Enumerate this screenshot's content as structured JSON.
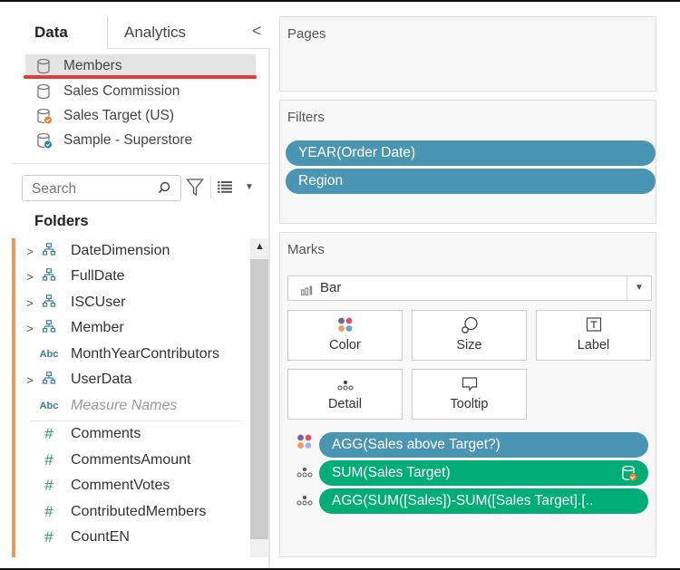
{
  "tabs": {
    "data": "Data",
    "analytics": "Analytics",
    "collapse_glyph": "<"
  },
  "datasources": [
    {
      "name": "Members",
      "icon": "database-icon",
      "selected": true
    },
    {
      "name": "Sales Commission",
      "icon": "database-icon",
      "selected": false
    },
    {
      "name": "Sales Target (US)",
      "icon": "database-secondary-icon",
      "selected": false
    },
    {
      "name": "Sample - Superstore",
      "icon": "database-primary-icon",
      "selected": false
    }
  ],
  "search": {
    "placeholder": "Search"
  },
  "folders_label": "Folders",
  "fields": [
    {
      "name": "DateDimension",
      "type": "hierarchy",
      "expandable": true
    },
    {
      "name": "FullDate",
      "type": "hierarchy",
      "expandable": true
    },
    {
      "name": "ISCUser",
      "type": "hierarchy",
      "expandable": true
    },
    {
      "name": "Member",
      "type": "hierarchy",
      "expandable": true
    },
    {
      "name": "MonthYearContributors",
      "type": "string",
      "expandable": false
    },
    {
      "name": "UserData",
      "type": "hierarchy",
      "expandable": true
    },
    {
      "name": "Measure Names",
      "type": "string",
      "expandable": false,
      "italic": true
    }
  ],
  "measures": [
    {
      "name": "Comments"
    },
    {
      "name": "CommentsAmount"
    },
    {
      "name": "CommentVotes"
    },
    {
      "name": "ContributedMembers"
    },
    {
      "name": "CountEN"
    }
  ],
  "type_glyphs": {
    "string": "Abc",
    "measure": "#",
    "expand": ">"
  },
  "pages": {
    "title": "Pages"
  },
  "filters": {
    "title": "Filters",
    "pills": [
      "YEAR(Order Date)",
      "Region"
    ]
  },
  "marks": {
    "title": "Marks",
    "mark_type": "Bar",
    "buttons": [
      "Color",
      "Size",
      "Label",
      "Detail",
      "Tooltip"
    ],
    "shelf": [
      {
        "label": "AGG(Sales above Target?)",
        "role": "color",
        "color": "#4a96b2"
      },
      {
        "label": "SUM(Sales Target)",
        "role": "detail",
        "color": "#00ad74",
        "secondary_source": true
      },
      {
        "label": "AGG(SUM([Sales])-SUM([Sales Target].[..",
        "role": "detail",
        "color": "#00ad74"
      }
    ]
  },
  "colors": {
    "highlight_underline": "#e03c3c",
    "dimension_pill": "#4a96b2",
    "measure_pill": "#00ad74",
    "measures_accent": "#f0975a",
    "measure_icon": "#2a9a5e",
    "dimension_icon": "#3c7d9b"
  }
}
